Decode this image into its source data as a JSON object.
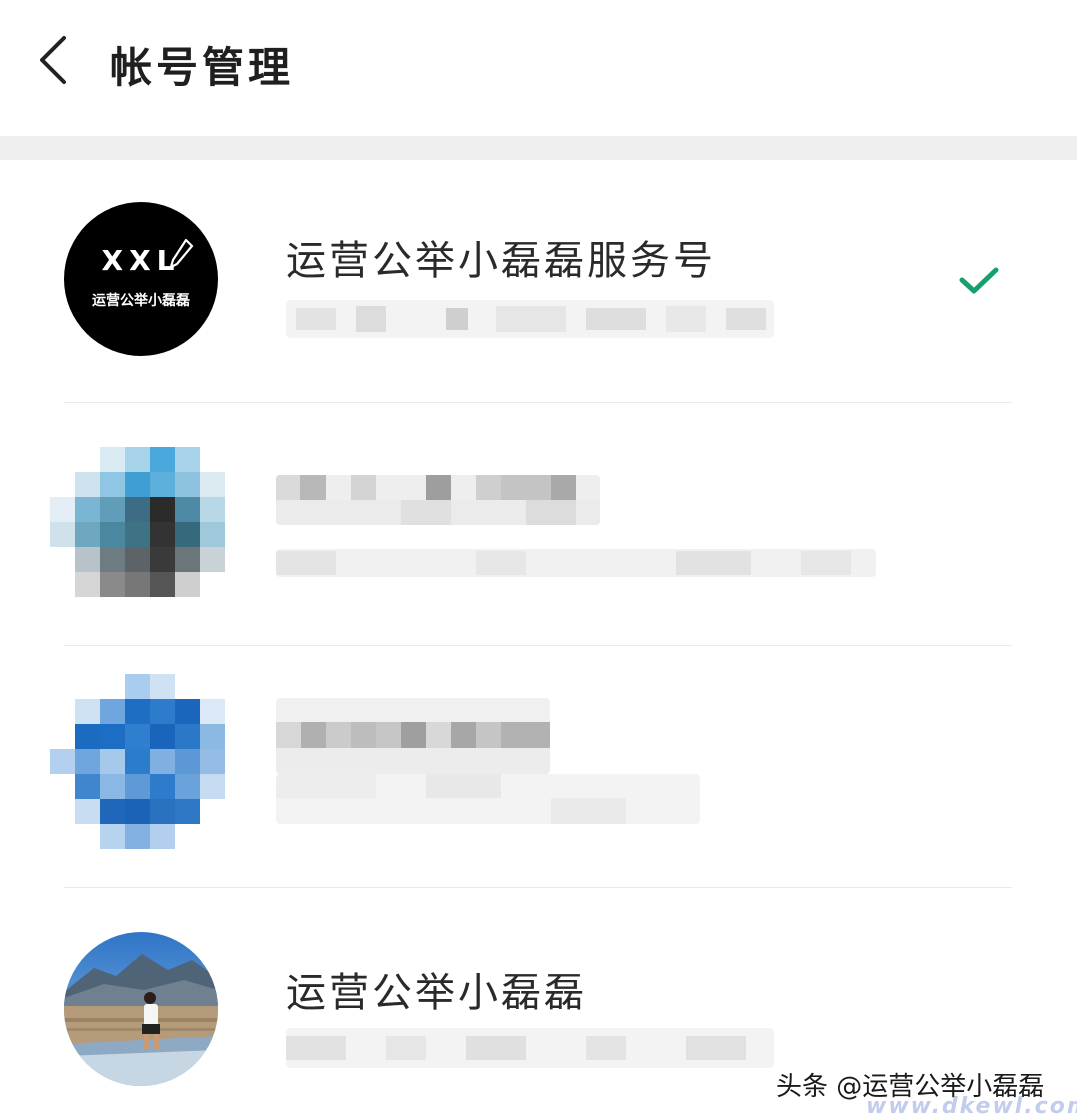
{
  "header": {
    "title": "帐号管理"
  },
  "accounts": [
    {
      "name": "运营公举小磊磊服务号",
      "logo_text": "XXL",
      "logo_subtext": "运营公举小磊磊",
      "selected": true
    },
    {
      "name": "",
      "selected": false
    },
    {
      "name": "",
      "selected": false
    },
    {
      "name": "运营公举小磊磊",
      "selected": false
    }
  ],
  "colors": {
    "check": "#17a06b",
    "divider": "#e9e9e9",
    "section_bg": "#efefef"
  },
  "icons": {
    "back": "chevron-left-icon",
    "selected": "check-icon"
  },
  "watermark": {
    "text": "头条 @运营公举小磊磊",
    "site": "www.dkewl.com"
  }
}
